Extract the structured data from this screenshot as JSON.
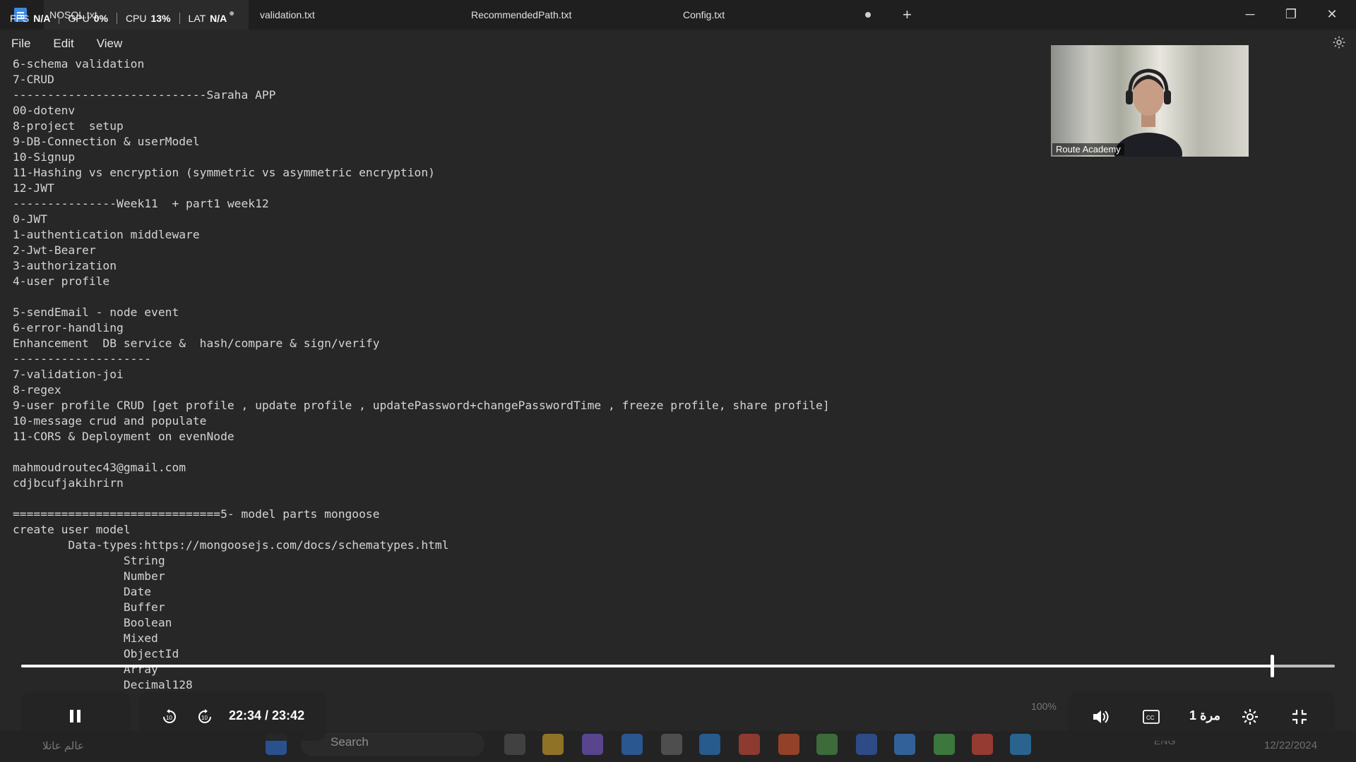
{
  "stats": {
    "fps_label": "FPS",
    "fps_value": "N/A",
    "gpu_label": "GPU",
    "gpu_value": "0%",
    "cpu_label": "CPU",
    "cpu_value": "13%",
    "lat_label": "LAT",
    "lat_value": "N/A"
  },
  "tabs": [
    {
      "label": "NOSQL.txt",
      "active": true
    },
    {
      "label": "validation.txt"
    },
    {
      "label": "RecommendedPath.txt"
    },
    {
      "label": "Config.txt",
      "unsaved": true
    }
  ],
  "menu": {
    "file": "File",
    "edit": "Edit",
    "view": "View"
  },
  "webcam": {
    "label": "Route Academy"
  },
  "editor_lines": [
    "6-schema validation",
    "7-CRUD",
    "----------------------------Saraha APP",
    "00-dotenv",
    "8-project  setup",
    "9-DB-Connection & userModel",
    "10-Signup",
    "11-Hashing vs encryption (symmetric vs asymmetric encryption)",
    "12-JWT",
    "---------------Week11  + part1 week12",
    "0-JWT",
    "1-authentication middleware",
    "2-Jwt-Bearer",
    "3-authorization",
    "4-user profile",
    "",
    "5-sendEmail - node event",
    "6-error-handling",
    "Enhancement  DB service &  hash/compare & sign/verify",
    "--------------------",
    "7-validation-joi",
    "8-regex",
    "9-user profile CRUD [get profile , update profile , updatePassword+changePasswordTime , freeze profile, share profile]",
    "10-message crud and populate",
    "11-CORS & Deployment on evenNode",
    "",
    "mahmoudroutec43@gmail.com",
    "cdjbcufjakihrirn",
    "",
    "==============================5- model parts mongoose",
    "create user model",
    "        Data-types:https://mongoosejs.com/docs/schematypes.html",
    "                String",
    "                Number",
    "                Date",
    "                Buffer",
    "                Boolean",
    "                Mixed",
    "                ObjectId",
    "                Array",
    "                Decimal128"
  ],
  "player": {
    "time": "22:34 / 23:42",
    "progress_fraction": 0.952,
    "speed": "1 مرة",
    "zoom": "100%"
  },
  "taskbar": {
    "search_placeholder": "Search",
    "weather": "عالم عاتلا",
    "lang": "ENG",
    "date": "12/22/2024"
  },
  "colors": {
    "accent": "#3b8ae6",
    "squiggle": "#dd3333"
  }
}
